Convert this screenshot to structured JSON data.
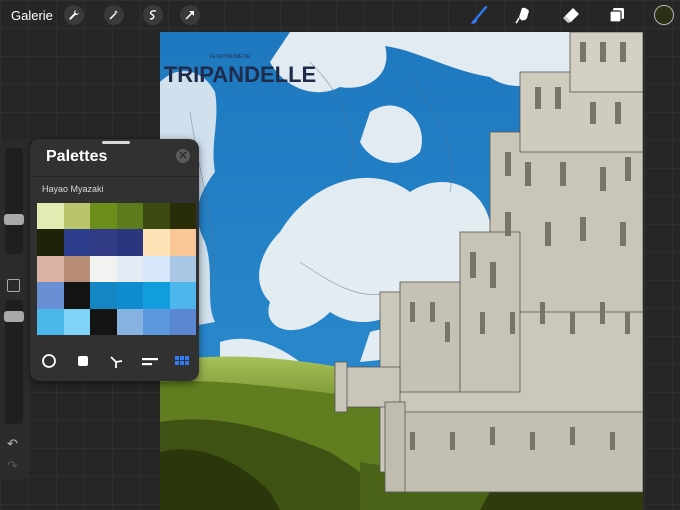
{
  "topbar": {
    "gallery_label": "Galerie",
    "left_tools": [
      {
        "name": "wrench-icon"
      },
      {
        "name": "magic-wand-icon"
      },
      {
        "name": "selection-icon"
      },
      {
        "name": "transform-arrow-icon"
      }
    ],
    "right_tools": [
      {
        "name": "brush-icon",
        "active": true
      },
      {
        "name": "smudge-icon"
      },
      {
        "name": "eraser-icon"
      },
      {
        "name": "layers-icon"
      }
    ],
    "current_color": "#2b2f13",
    "accent": "#2f7cf6"
  },
  "artwork": {
    "logo_top": "LE ROYAUME DE",
    "logo_main": "TRIPANDELLE"
  },
  "palettes_panel": {
    "title": "Palettes",
    "palette_name": "Hayao Myazaki",
    "swatches": [
      "#e1ebb2",
      "#b9c46b",
      "#6c8e1a",
      "#5b7b1d",
      "#3c4a0f",
      "#262d08",
      "#1e2209",
      "#2e3e8f",
      "#313b86",
      "#2a367e",
      "#fde3b5",
      "#f9c796",
      "#dbb1a1",
      "#b88d78",
      "#f2f2f0",
      "#e3ecf4",
      "#d6e6fb",
      "#a9c6e5",
      "#6a8fd5",
      "#141414",
      "#1486c3",
      "#0f8bcf",
      "#129ddd",
      "#4eb6ec",
      "#4bb8ea",
      "#7fd3f6",
      "#141414",
      "#87b2e0",
      "#5c97dd",
      "#5a86d2"
    ],
    "bottom_icons": [
      "disc-icon",
      "square-icon",
      "harmony-icon",
      "value-icon",
      "palette-grid-icon"
    ]
  },
  "sidebar": {
    "undo_icon": "undo-icon",
    "redo_icon": "redo-icon",
    "undo_glyph": "↶",
    "redo_glyph": "↷"
  }
}
